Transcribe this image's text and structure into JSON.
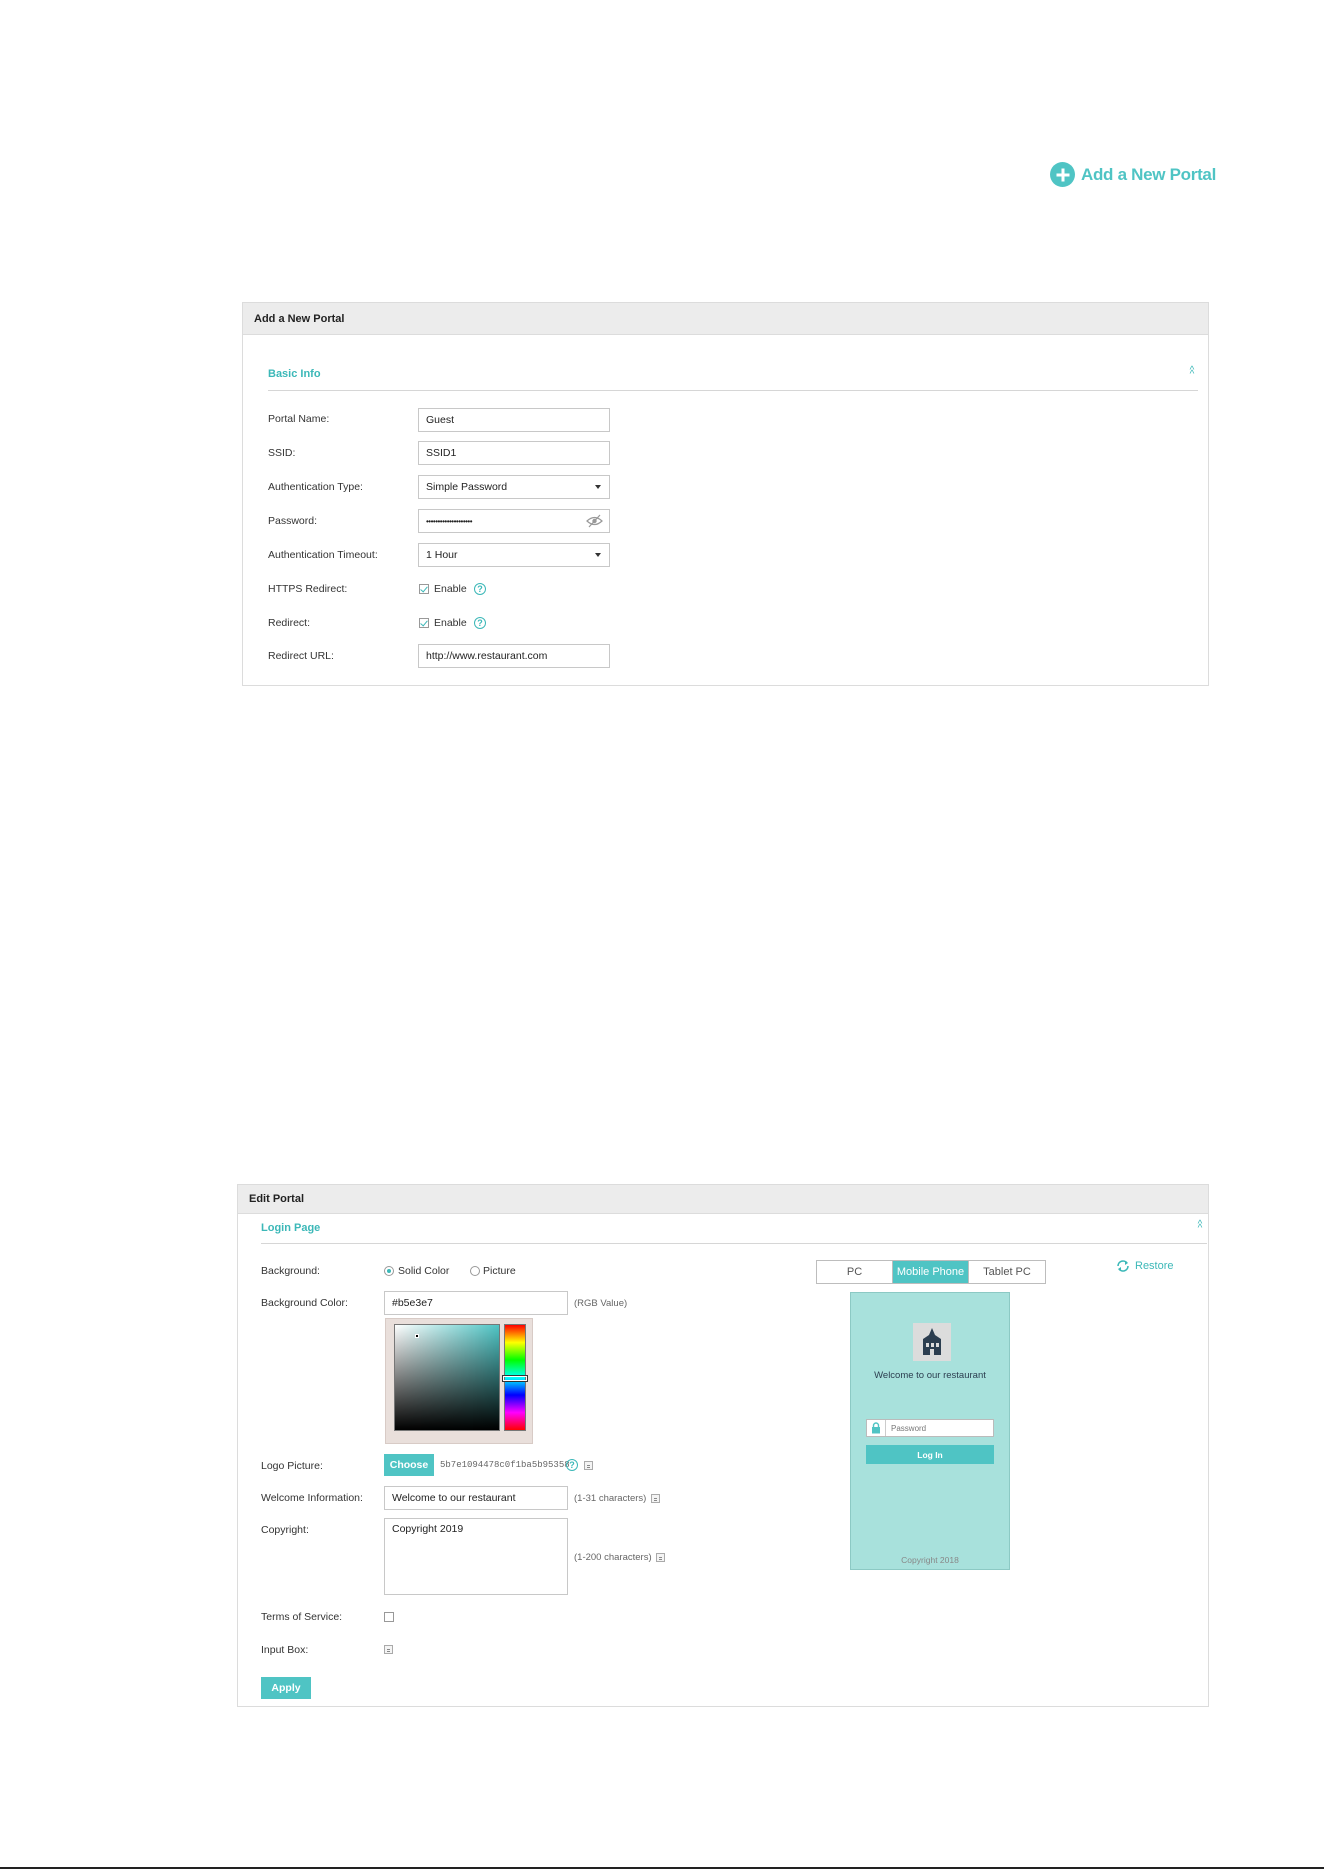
{
  "add_portal_link": {
    "label": "Add a New Portal"
  },
  "add_panel": {
    "title": "Add a New Portal",
    "section": "Basic Info",
    "fields": {
      "portal_name": {
        "label": "Portal Name:",
        "value": "Guest"
      },
      "ssid": {
        "label": "SSID:",
        "value": "SSID1"
      },
      "auth_type": {
        "label": "Authentication Type:",
        "value": "Simple Password"
      },
      "password": {
        "label": "Password:",
        "value": "••••••••••••••••••••"
      },
      "auth_timeout": {
        "label": "Authentication Timeout:",
        "value": "1 Hour"
      },
      "https_redirect": {
        "label": "HTTPS Redirect:",
        "option": "Enable",
        "checked": true
      },
      "redirect": {
        "label": "Redirect:",
        "option": "Enable",
        "checked": true
      },
      "redirect_url": {
        "label": "Redirect URL:",
        "value": "http://www.restaurant.com"
      }
    }
  },
  "edit_panel": {
    "title": "Edit Portal",
    "section": "Login Page",
    "background": {
      "label": "Background:",
      "options": [
        "Solid Color",
        "Picture"
      ],
      "selected": "Solid Color"
    },
    "background_color": {
      "label": "Background Color:",
      "value": "#b5e3e7",
      "hint": "(RGB Value)"
    },
    "logo_picture": {
      "label": "Logo Picture:",
      "button": "Choose",
      "filename": "5b7e1094478c0f1ba5b95358"
    },
    "welcome_info": {
      "label": "Welcome Information:",
      "value": "Welcome to our restaurant",
      "hint": "(1-31 characters)"
    },
    "copyright": {
      "label": "Copyright:",
      "value": "Copyright 2019",
      "hint": "(1-200 characters)"
    },
    "terms": {
      "label": "Terms of Service:"
    },
    "input_box": {
      "label": "Input Box:"
    },
    "apply": "Apply",
    "preview_tabs": [
      "PC",
      "Mobile Phone",
      "Tablet PC"
    ],
    "active_tab": "Mobile Phone",
    "restore": "Restore",
    "preview": {
      "welcome": "Welcome to our restaurant",
      "password_placeholder": "Password",
      "login": "Log In",
      "copyright": "Copyright 2018"
    }
  },
  "colors": {
    "accent": "#4fc4c4",
    "preview_bg": "#a8e1dc",
    "header_bg": "#ececec"
  }
}
